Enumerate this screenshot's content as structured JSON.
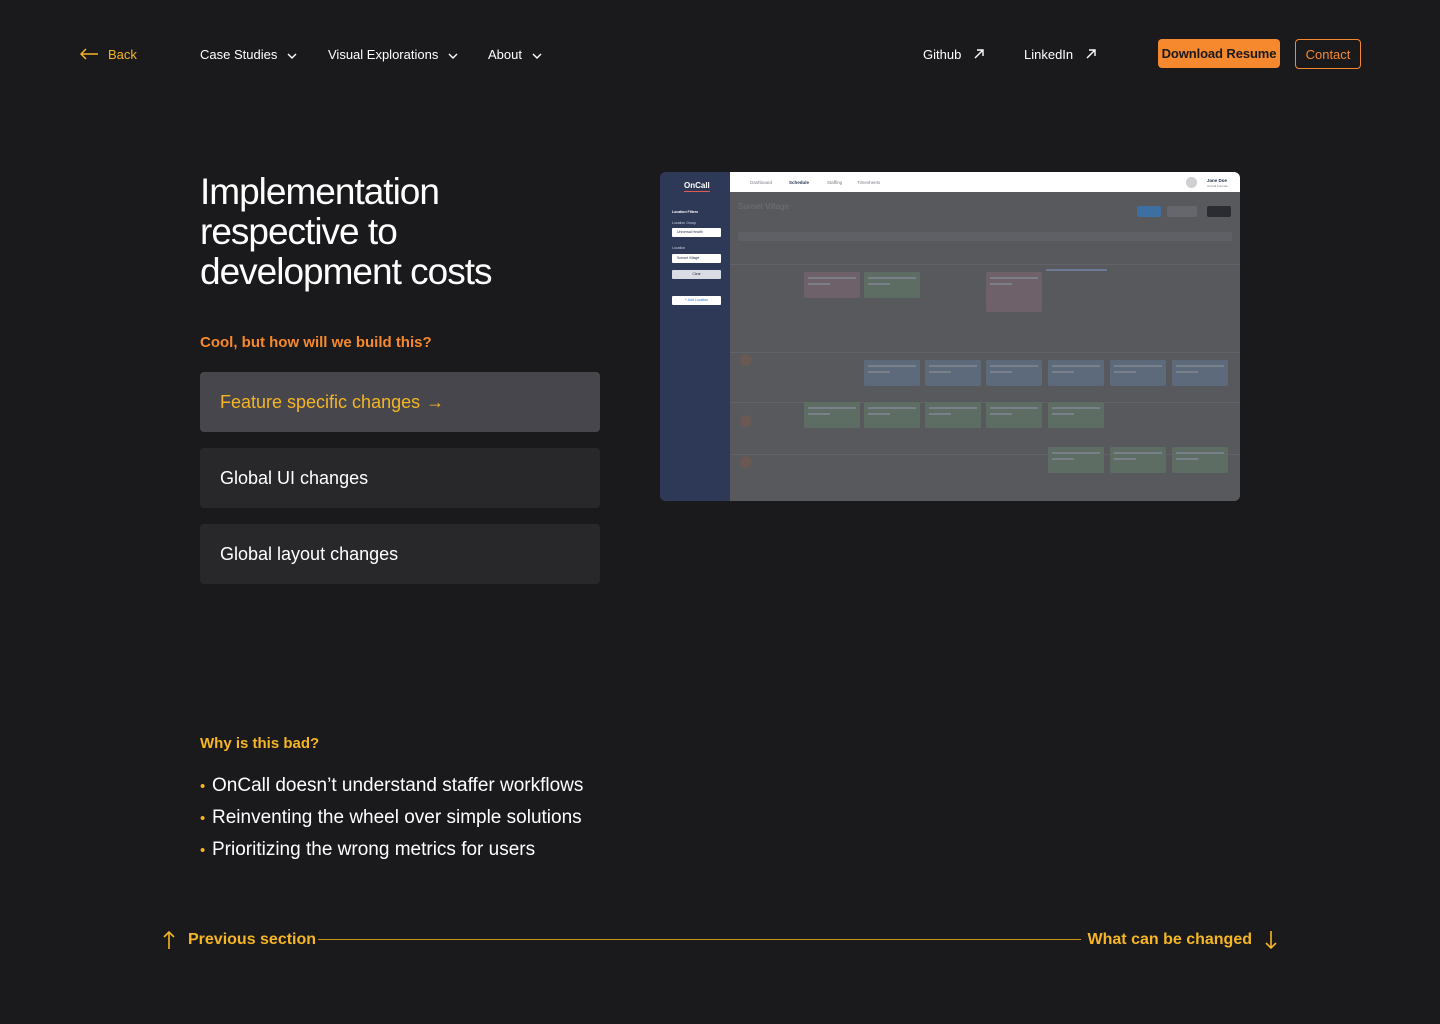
{
  "nav": {
    "back": "Back",
    "items": [
      {
        "label": "Case Studies"
      },
      {
        "label": "Visual Explorations"
      },
      {
        "label": "About"
      }
    ],
    "github": "Github",
    "linkedin": "LinkedIn",
    "download": "Download Resume",
    "contact": "Contact"
  },
  "hero": {
    "title": "Implementation\nrespective to\ndevelopment costs",
    "question": "Cool, but how will we build this?",
    "options": [
      {
        "label": "Feature specific changes",
        "arrow": "→",
        "active": true
      },
      {
        "label": "Global UI changes",
        "active": false
      },
      {
        "label": "Global layout changes",
        "active": false
      }
    ]
  },
  "screenshot": {
    "brand": "OnCall",
    "location_filters": "Location Filters",
    "location_group_label": "Location Group",
    "location_group_value": "Universal Health",
    "location_label": "Location",
    "location_value": "Sunset Village",
    "clear": "Clear",
    "add_location": "+ Add Location",
    "tabs": [
      "Dashboard",
      "Schedule",
      "Staffing",
      "Timesheets"
    ],
    "user_name": "Jane Doe",
    "user_role": "OnCall Founder",
    "page_title": "Sunset Village"
  },
  "why": {
    "heading": "Why is this bad?",
    "bullets": [
      "OnCall doesn’t understand staffer workflows",
      "Reinventing the wheel over simple solutions",
      "Prioritizing the wrong metrics for users"
    ]
  },
  "footer": {
    "prev": "Previous section",
    "next": "What can be changed"
  },
  "colors": {
    "background": "#1a1a1c",
    "accent_yellow": "#f5b524",
    "accent_orange": "#f6882d",
    "card": "#28282b",
    "card_active": "#46464c"
  }
}
